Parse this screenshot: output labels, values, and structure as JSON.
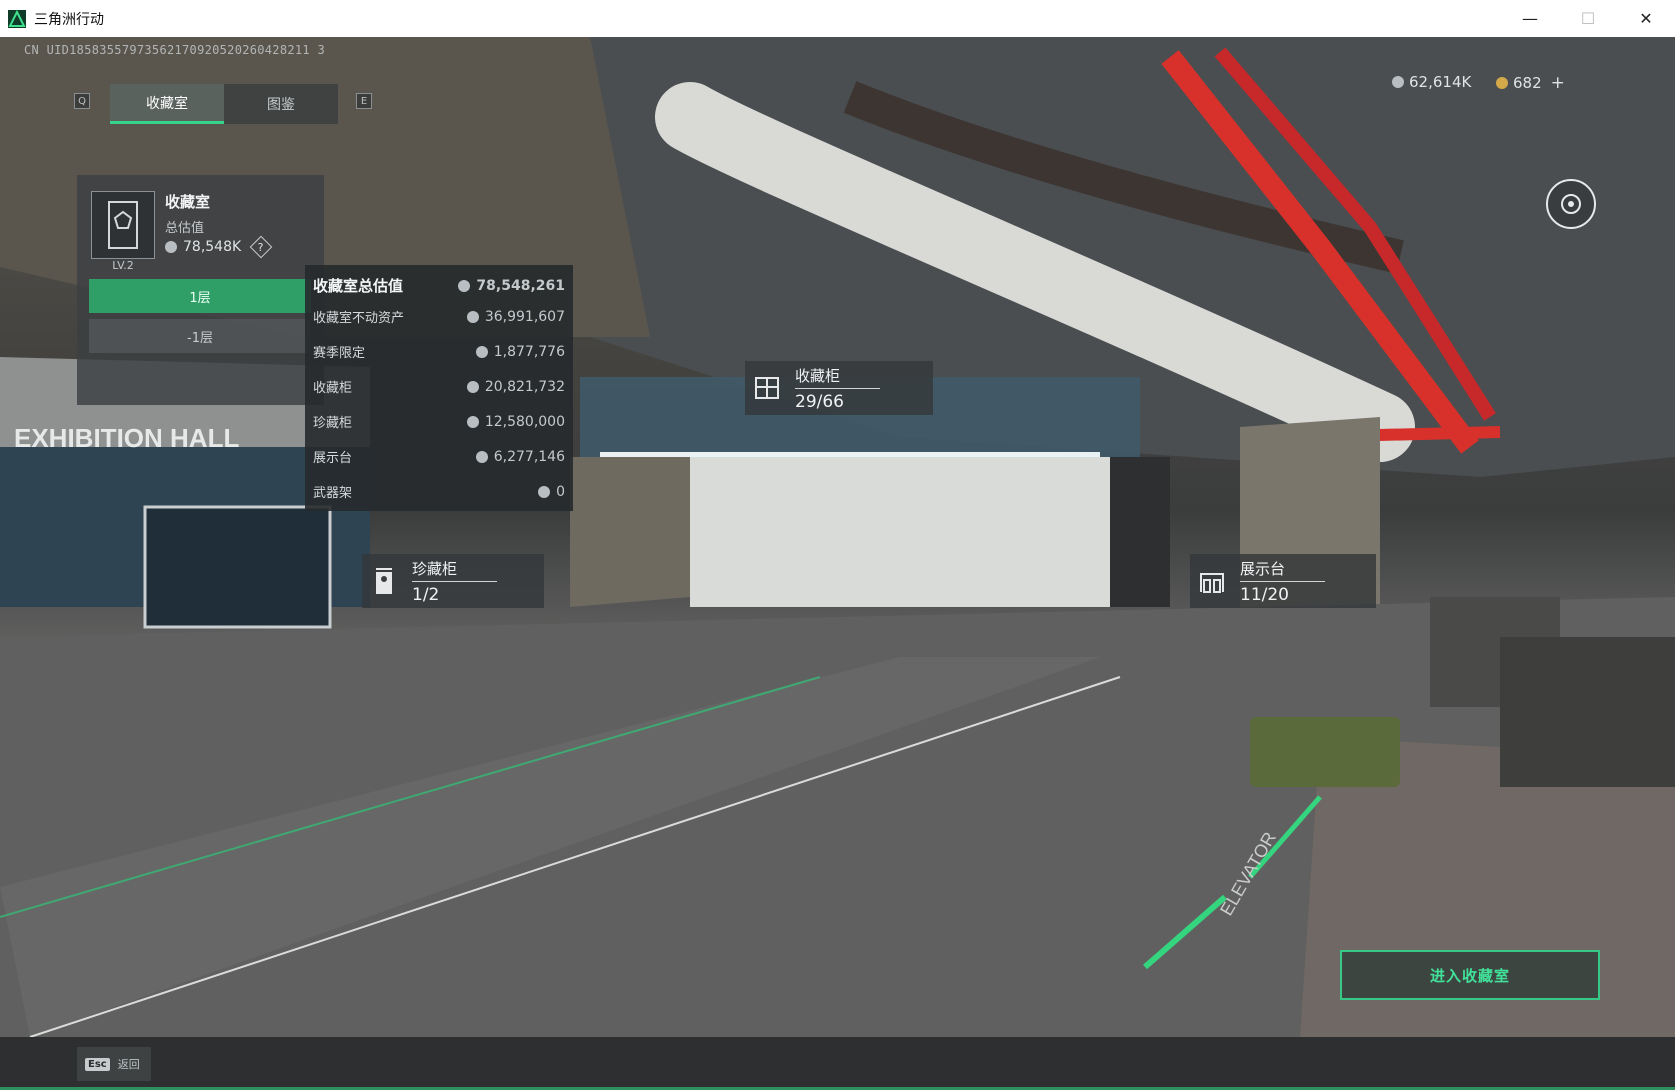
{
  "window": {
    "title": "三角洲行动",
    "minimize": "—",
    "maximize": "☐",
    "close": "✕"
  },
  "uid": "CN UID18583557973562170920520260428211 3",
  "nav": {
    "key_left": "Q",
    "key_right": "E",
    "tabs": [
      {
        "label": "收藏室",
        "active": true
      },
      {
        "label": "图鉴",
        "active": false
      }
    ]
  },
  "currency": {
    "silver": "62,614K",
    "gold": "682",
    "add": "+"
  },
  "summary": {
    "name": "收藏室",
    "level": "LV.2",
    "value_label": "总估值",
    "value": "78,548K",
    "help": "?",
    "floors": [
      "1层",
      "-1层"
    ]
  },
  "breakdown": {
    "title": "收藏室总估值",
    "total": "78,548,261",
    "rows": [
      {
        "label": "收藏室不动资产",
        "value": "36,991,607"
      },
      {
        "label": "赛季限定",
        "value": "1,877,776"
      },
      {
        "label": "收藏柜",
        "value": "20,821,732"
      },
      {
        "label": "珍藏柜",
        "value": "12,580,000"
      },
      {
        "label": "展示台",
        "value": "6,277,146"
      },
      {
        "label": "武器架",
        "value": "0"
      }
    ]
  },
  "markers": {
    "cabinet": {
      "title": "收藏柜",
      "count": "29/66"
    },
    "treasure": {
      "title": "珍藏柜",
      "count": "1/2"
    },
    "display": {
      "title": "展示台",
      "count": "11/20"
    }
  },
  "scene": {
    "hall_sign": "EXHIBITION HALL",
    "elevator": "ELEVATOR"
  },
  "enter_button": "进入收藏室",
  "bottom": {
    "esc_key": "Esc",
    "esc_label": "返回"
  },
  "colors": {
    "accent_green": "#37d38a",
    "pipe_red": "#d8312b"
  }
}
